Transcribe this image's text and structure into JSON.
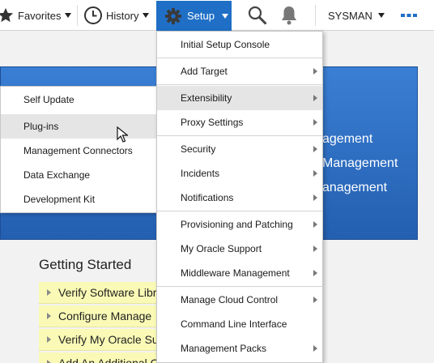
{
  "toolbar": {
    "favorites_label": "Favorites",
    "history_label": "History",
    "setup_label": "Setup",
    "user_label": "SYSMAN"
  },
  "banner": {
    "lines": [
      "agement",
      "Management",
      "anagement"
    ]
  },
  "getting_started": {
    "title": "Getting Started",
    "items": [
      "Verify Software Libr",
      "Configure Manage",
      "Verify My Oracle Su",
      "Add An Additional Ora"
    ]
  },
  "submenu": {
    "items": [
      "Self Update",
      "Plug-ins",
      "Management Connectors",
      "Data Exchange",
      "Development Kit"
    ],
    "hovered": "Plug-ins"
  },
  "setup_menu": {
    "items": [
      {
        "label": "Initial Setup Console",
        "submenu": false
      },
      {
        "label": "Add Target",
        "submenu": true
      },
      {
        "label": "Extensibility",
        "submenu": true
      },
      {
        "label": "Proxy Settings",
        "submenu": true
      },
      {
        "label": "Security",
        "submenu": true
      },
      {
        "label": "Incidents",
        "submenu": true
      },
      {
        "label": "Notifications",
        "submenu": true
      },
      {
        "label": "Provisioning and Patching",
        "submenu": true
      },
      {
        "label": "My Oracle Support",
        "submenu": true
      },
      {
        "label": "Middleware Management",
        "submenu": true
      },
      {
        "label": "Manage Cloud Control",
        "submenu": true
      },
      {
        "label": "Command Line Interface",
        "submenu": false
      },
      {
        "label": "Management Packs",
        "submenu": true
      }
    ],
    "active": "Extensibility"
  },
  "icons": [
    "star-icon",
    "clock-icon",
    "gear-icon",
    "search-icon",
    "bell-icon",
    "more-icon",
    "mouse-pointer-icon"
  ],
  "colors": {
    "setup_active": "#1f6fc6",
    "banner": "#2f6fc4",
    "getting_started_bg": "#fafab6"
  }
}
